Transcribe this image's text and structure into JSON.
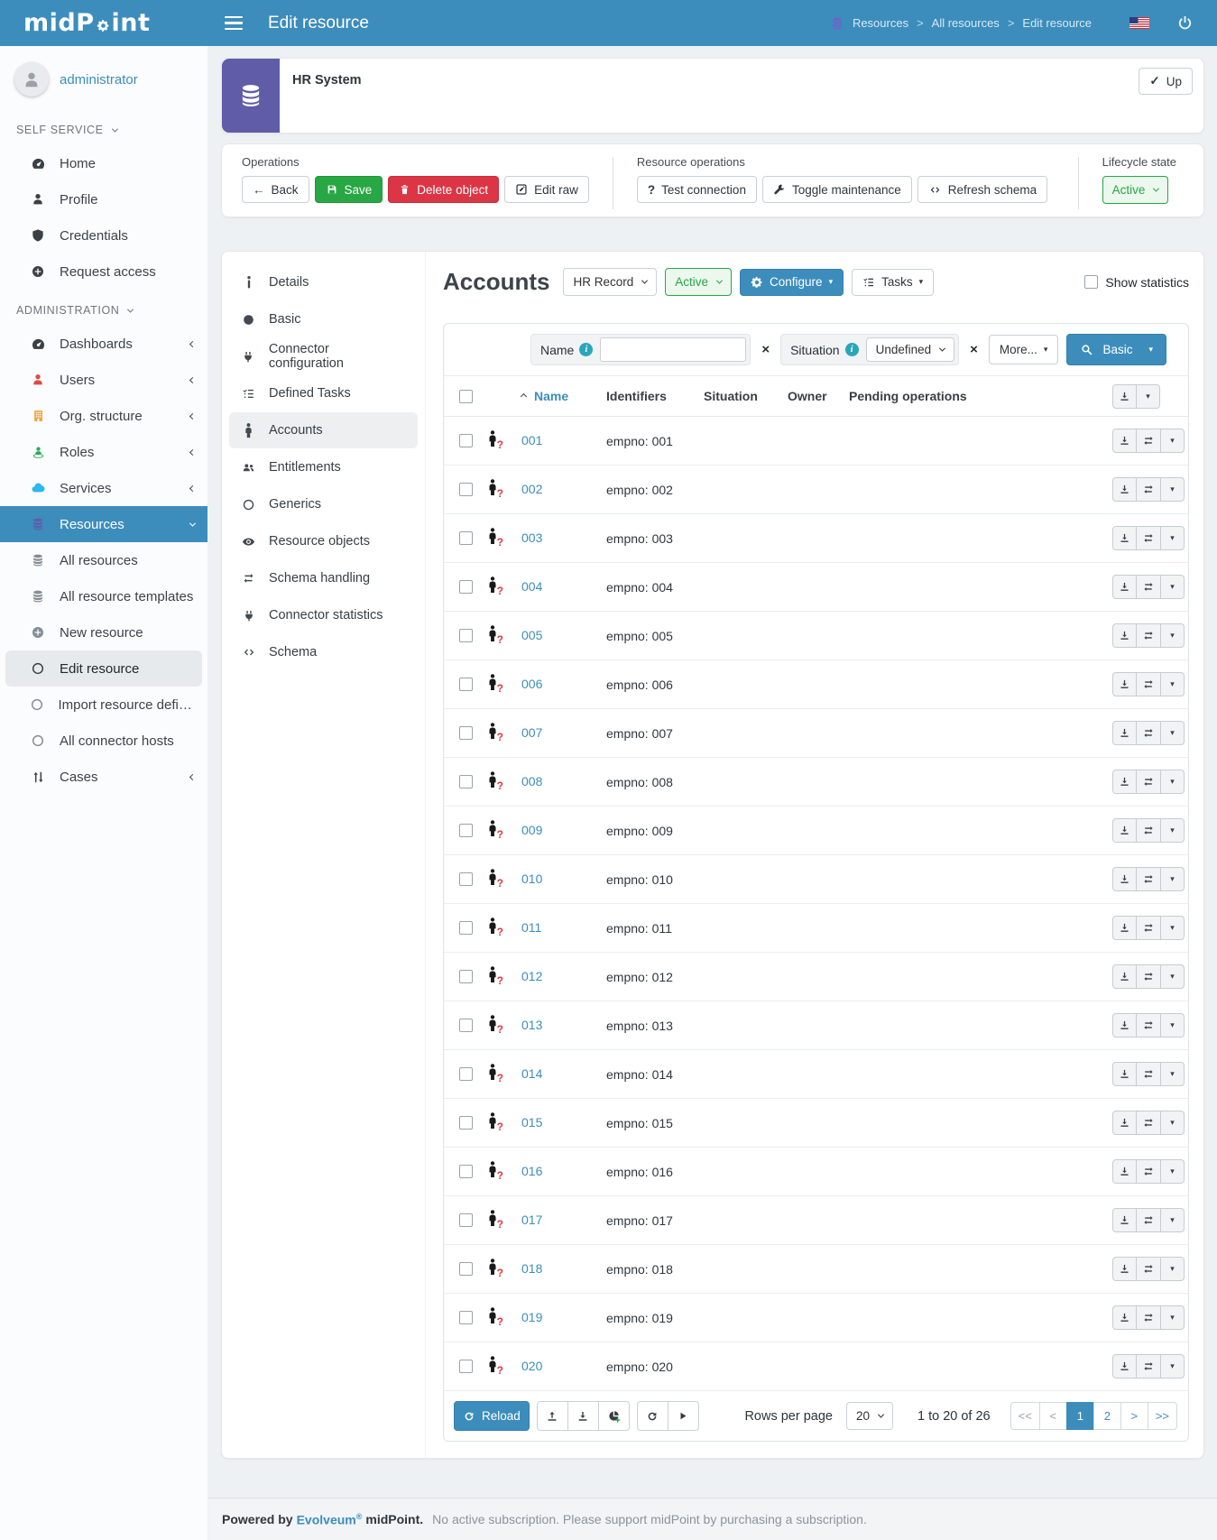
{
  "topbar": {
    "logo_left": "midP",
    "logo_right": "int",
    "title": "Edit resource",
    "breadcrumb": [
      "Resources",
      "All resources",
      "Edit resource"
    ]
  },
  "sidebar": {
    "user": "administrator",
    "self_label": "SELF SERVICE",
    "self_items": [
      {
        "label": "Home"
      },
      {
        "label": "Profile"
      },
      {
        "label": "Credentials"
      },
      {
        "label": "Request access"
      }
    ],
    "admin_label": "ADMINISTRATION",
    "admin_items": [
      {
        "label": "Dashboards"
      },
      {
        "label": "Users"
      },
      {
        "label": "Org. structure"
      },
      {
        "label": "Roles"
      },
      {
        "label": "Services"
      },
      {
        "label": "Resources"
      },
      {
        "label": "All resources"
      },
      {
        "label": "All resource templates"
      },
      {
        "label": "New resource"
      },
      {
        "label": "Edit resource"
      },
      {
        "label": "Import resource definit…"
      },
      {
        "label": "All connector hosts"
      },
      {
        "label": "Cases"
      }
    ]
  },
  "resource": {
    "title": "HR System",
    "up_label": "Up"
  },
  "operations": {
    "group1_label": "Operations",
    "back": "Back",
    "save": "Save",
    "delete": "Delete object",
    "edit_raw": "Edit raw",
    "group2_label": "Resource operations",
    "test": "Test connection",
    "toggle": "Toggle maintenance",
    "refresh": "Refresh schema",
    "lifecycle_label": "Lifecycle state",
    "lifecycle_value": "Active"
  },
  "nav": {
    "items": [
      {
        "label": "Details"
      },
      {
        "label": "Basic"
      },
      {
        "label": "Connector configuration"
      },
      {
        "label": "Defined Tasks"
      },
      {
        "label": "Accounts"
      },
      {
        "label": "Entitlements"
      },
      {
        "label": "Generics"
      },
      {
        "label": "Resource objects"
      },
      {
        "label": "Schema handling"
      },
      {
        "label": "Connector statistics"
      },
      {
        "label": "Schema"
      }
    ],
    "selected": "Accounts"
  },
  "accounts": {
    "title": "Accounts",
    "type_value": "HR Record",
    "state_value": "Active",
    "configure_label": "Configure",
    "tasks_label": "Tasks",
    "show_statistics_label": "Show statistics",
    "search": {
      "name_label": "Name",
      "name_value": "",
      "situation_label": "Situation",
      "situation_value": "Undefined",
      "more_label": "More...",
      "button_label": "Basic"
    },
    "table": {
      "columns": {
        "name": "Name",
        "identifiers": "Identifiers",
        "situation": "Situation",
        "owner": "Owner",
        "pending": "Pending operations"
      },
      "rows": [
        {
          "name": "001",
          "identifiers": "empno: 001"
        },
        {
          "name": "002",
          "identifiers": "empno: 002"
        },
        {
          "name": "003",
          "identifiers": "empno: 003"
        },
        {
          "name": "004",
          "identifiers": "empno: 004"
        },
        {
          "name": "005",
          "identifiers": "empno: 005"
        },
        {
          "name": "006",
          "identifiers": "empno: 006"
        },
        {
          "name": "007",
          "identifiers": "empno: 007"
        },
        {
          "name": "008",
          "identifiers": "empno: 008"
        },
        {
          "name": "009",
          "identifiers": "empno: 009"
        },
        {
          "name": "010",
          "identifiers": "empno: 010"
        },
        {
          "name": "011",
          "identifiers": "empno: 011"
        },
        {
          "name": "012",
          "identifiers": "empno: 012"
        },
        {
          "name": "013",
          "identifiers": "empno: 013"
        },
        {
          "name": "014",
          "identifiers": "empno: 014"
        },
        {
          "name": "015",
          "identifiers": "empno: 015"
        },
        {
          "name": "016",
          "identifiers": "empno: 016"
        },
        {
          "name": "017",
          "identifiers": "empno: 017"
        },
        {
          "name": "018",
          "identifiers": "empno: 018"
        },
        {
          "name": "019",
          "identifiers": "empno: 019"
        },
        {
          "name": "020",
          "identifiers": "empno: 020"
        }
      ]
    },
    "footer": {
      "reload_label": "Reload",
      "rows_per_page_label": "Rows per page",
      "rows_per_page_value": "20",
      "count_label": "1 to 20 of 26",
      "pages": [
        {
          "label": "<<",
          "muted": true
        },
        {
          "label": "<",
          "muted": true
        },
        {
          "label": "1",
          "active": true
        },
        {
          "label": "2"
        },
        {
          "label": ">"
        },
        {
          "label": ">>"
        }
      ]
    }
  },
  "page_footer": {
    "powered_by": "Powered by",
    "brand": "Evolveum",
    "reg": "®",
    "product": "midPoint.",
    "note": "No active subscription. Please support midPoint by purchasing a subscription."
  },
  "colors": {
    "accent": "#3c8dbc",
    "purple": "#605ca8",
    "green": "#28a745",
    "red": "#dc3545"
  }
}
